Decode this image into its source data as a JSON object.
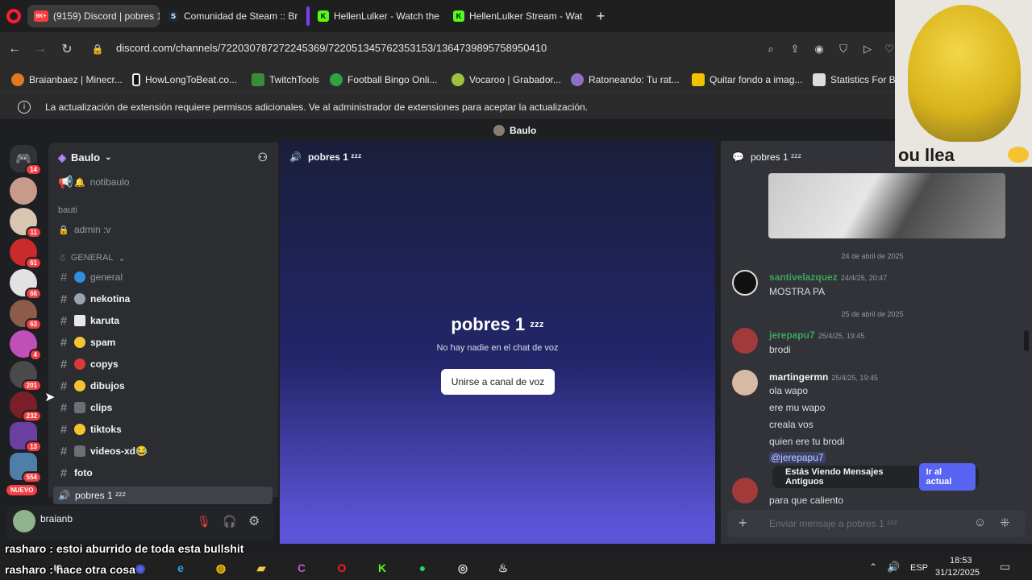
{
  "tabs": [
    {
      "label": "(9159) Discord | pobres 1",
      "badge": "9K+"
    },
    {
      "label": "Comunidad de Steam :: Br"
    },
    {
      "label": "HellenLulker - Watch the"
    },
    {
      "label": "HellenLulker Stream - Wat"
    }
  ],
  "url": "discord.com/channels/722030787272245369/722051345762353153/1364739895758950410",
  "bookmarks": [
    "Braianbaez | Minecr...",
    "HowLongToBeat.co...",
    "TwitchTools",
    "Football Bingo Onli...",
    "Vocaroo | Grabador...",
    "Ratoneando: Tu rat...",
    "Quitar fondo a imag...",
    "Statistics For Be"
  ],
  "info_bar": "La actualización de extensión requiere permisos adicionales. Ve al administrador de extensiones para aceptar la actualización.",
  "server": {
    "name": "Baulo"
  },
  "guild_badges": [
    "14",
    "11",
    "61",
    "66",
    "63",
    "4",
    "201",
    "232",
    "13",
    "554"
  ],
  "new_label": "NUEVO",
  "channels": {
    "notibaulo": "notibaulo",
    "cat_bauti": "bauti",
    "admin": "admin :v",
    "cat_general": "GENERAL",
    "list": [
      "general",
      "nekotina",
      "karuta",
      "spam",
      "copys",
      "dibujos",
      "clips",
      "tiktoks",
      "videos-xd😂",
      "foto"
    ],
    "voice_channel": "pobres 1 ᶻᶻᶻ"
  },
  "user": {
    "name": "braianb"
  },
  "voice": {
    "header": "pobres 1 ᶻᶻᶻ",
    "title": "pobres 1",
    "zzz": "ᶻᶻᶻ",
    "empty": "No hay nadie en el chat de voz",
    "join_button": "Unirse a canal de voz"
  },
  "chat": {
    "header": "pobres 1 ᶻᶻᶻ",
    "date1": "24 de abril de 2025",
    "date2": "25 de abril de 2025",
    "messages": [
      {
        "author": "santivelazquez",
        "time": "24/4/25, 20:47",
        "lines": [
          "MOSTRA PA"
        ]
      },
      {
        "author": "jerepapu7",
        "time": "25/4/25, 19:45",
        "lines": [
          "brodi"
        ]
      },
      {
        "author": "martingermn",
        "time": "25/4/25, 19:45",
        "lines": [
          "ola wapo",
          "ere mu wapo",
          "creala vos",
          "quien ere tu brodi"
        ],
        "mention": "@jerepapu7"
      }
    ],
    "last_line": "para que caliento",
    "old_notice": "Estás Viendo Mensajes Antiguos",
    "jump_button": "Ir al actual",
    "input_placeholder": "Enviar mensaje a pobres 1 ᶻᶻᶻ"
  },
  "overlay_chat": [
    {
      "user": "rasharo",
      "text": "estoi aburrido de toda esta bullshit"
    },
    {
      "user": "rasharo",
      "text": "hace otra cosa"
    }
  ],
  "webcam_caption": "ou llea",
  "taskbar": {
    "lang": "ESP",
    "time": "18:53",
    "date": "31/12/2025"
  }
}
